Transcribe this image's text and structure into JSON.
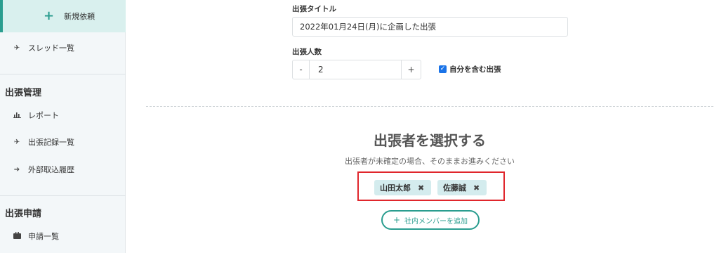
{
  "sidebar": {
    "new_request": "新規依頼",
    "thread_list": "スレッド一覧",
    "section_trip_mgmt": "出張管理",
    "report": "レポート",
    "trip_records": "出張記録一覧",
    "external_import": "外部取込履歴",
    "section_trip_apply": "出張申請",
    "application_list": "申請一覧"
  },
  "form": {
    "title_label": "出張タイトル",
    "title_value": "2022年01月24日(月)に企画した出張",
    "count_label": "出張人数",
    "count_minus": "-",
    "count_value": "2",
    "count_plus": "+",
    "include_self_label": "自分を含む出張",
    "include_self_checked": true
  },
  "travelers": {
    "heading": "出張者を選択する",
    "subtext": "出張者が未確定の場合、そのままお進みください",
    "selected": [
      "山田太郎",
      "佐藤誠"
    ],
    "remove_symbol": "✖",
    "add_button": "社内メンバーを追加",
    "add_symbol": "+"
  },
  "colors": {
    "accent": "#2a9d8f",
    "highlight_border": "#e0262c",
    "tag_bg": "#d4ecee",
    "checkbox": "#1a73e8"
  }
}
